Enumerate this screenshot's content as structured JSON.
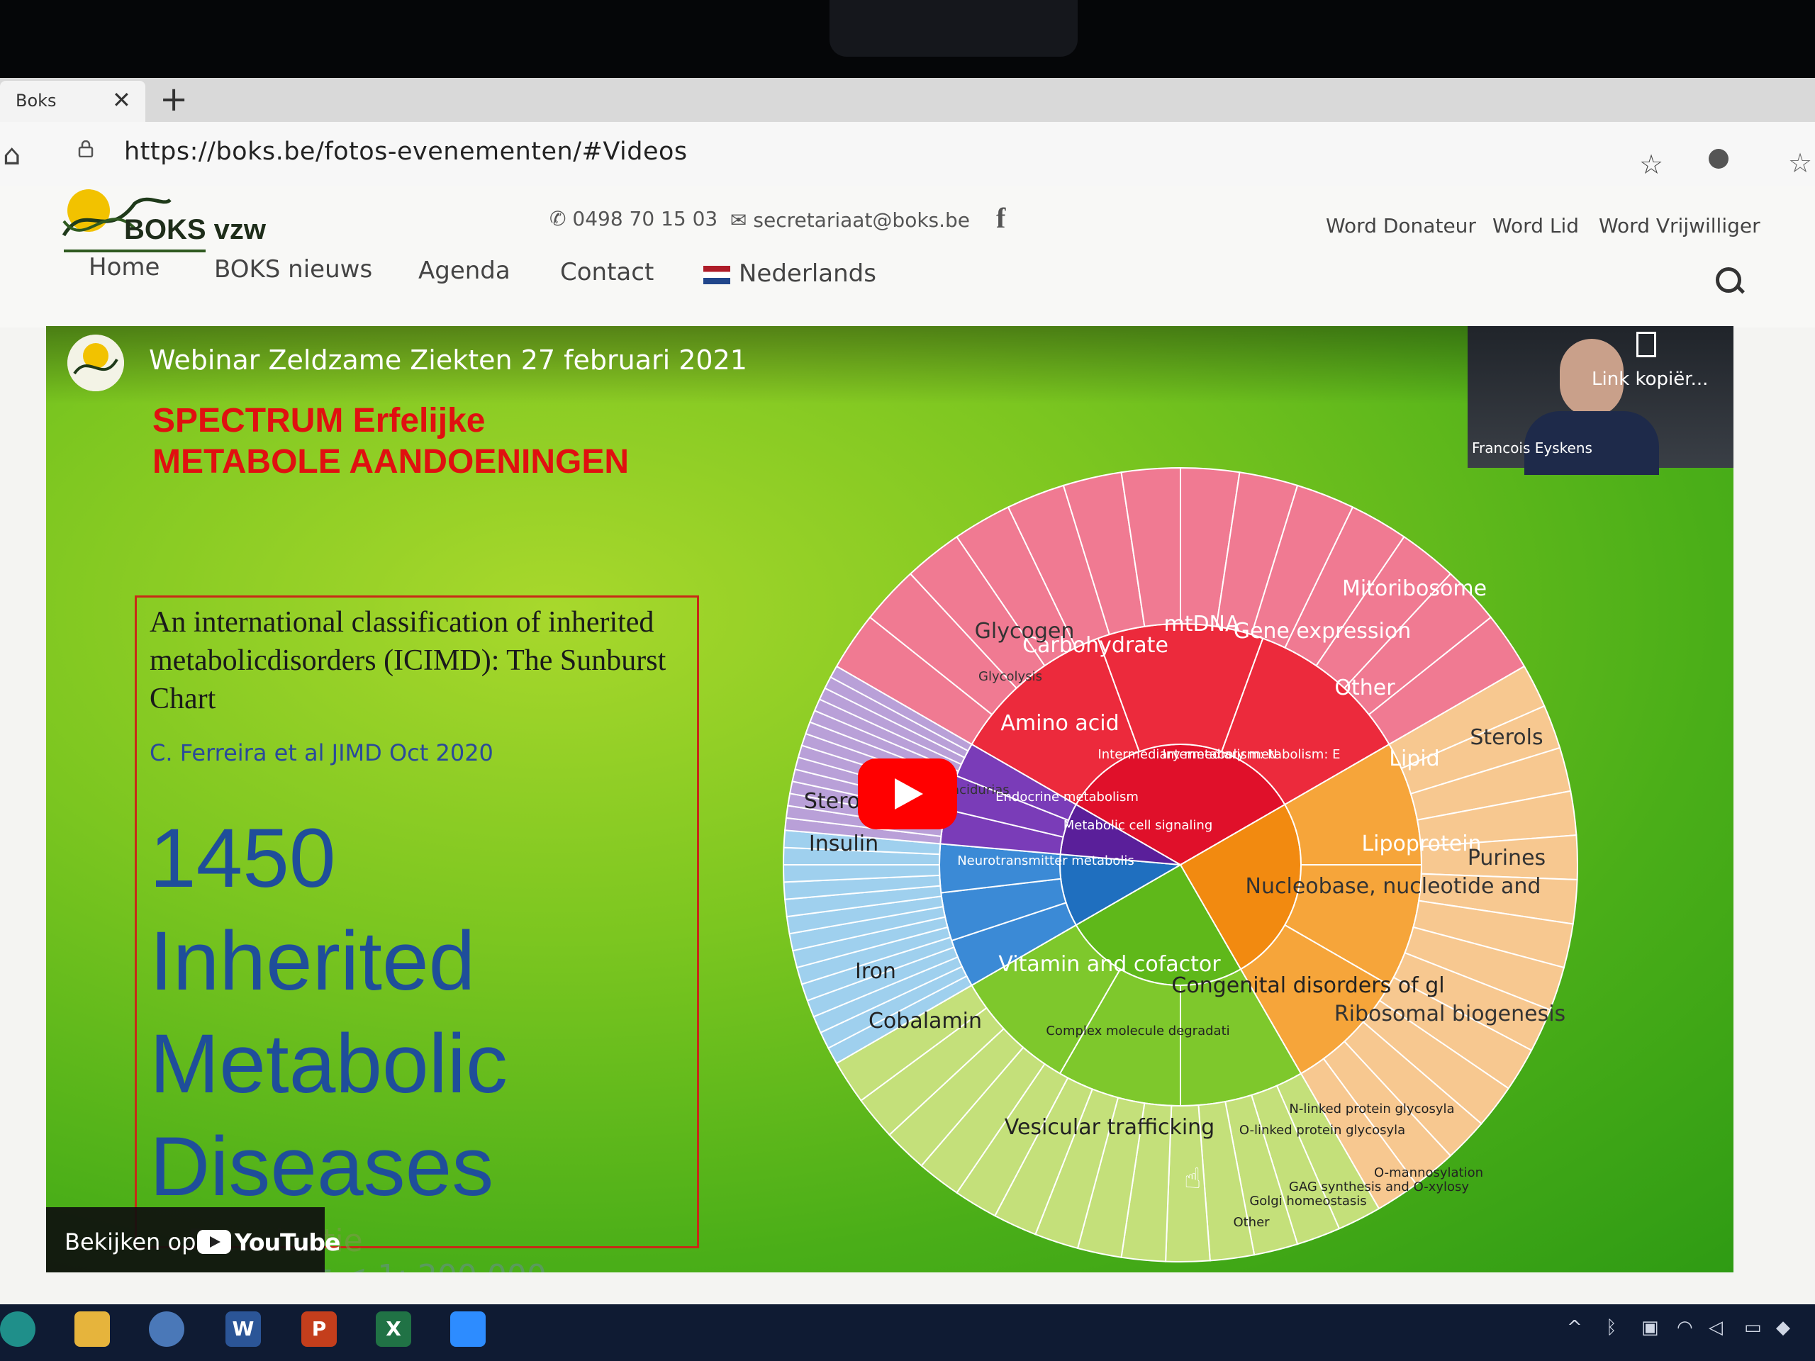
{
  "browser": {
    "tab_title": "Boks",
    "tab_close": "✕",
    "new_tab": "+",
    "url": "https://boks.be/fotos-evenementen/#Videos"
  },
  "site": {
    "logo_text": "BOKS vzw",
    "phone": "0498 70 15 03",
    "email": "secretariaat@boks.be",
    "facebook": "f",
    "top_links": [
      "Word Donateur",
      "Word Lid",
      "Word Vrijwilliger"
    ],
    "nav": [
      "Home",
      "BOKS nieuws",
      "Agenda",
      "Contact",
      "Nederlands"
    ]
  },
  "video": {
    "title": "Webinar Zeldzame Ziekten 27 februari 2021",
    "heading_line1": "SPECTRUM Erfelijke",
    "heading_line2": "METABOLE AANDOENINGEN",
    "box_title": "An international classification of inherited metabolicdisorders (ICIMD): The Sunburst Chart",
    "box_author": "C. Ferreira et al JIMD Oct 2020",
    "big_lines": [
      "1450",
      "Inherited",
      "Metabolic",
      "Diseases"
    ],
    "prevalence": "Prevalentie",
    "prevalence_value": "t < 1: 200.000",
    "watch_label": "Bekijken op",
    "youtube": "YouTube",
    "webcam_name": "Francois Eyskens",
    "copy_link": "Link kopiër..."
  },
  "sunburst_labels": [
    "Steroids",
    "Insulin",
    "Iron",
    "Cobalamin",
    "Amino acid",
    "Carbohydrate",
    "mtDNA",
    "Gene expression",
    "Other",
    "Mitoribosome",
    "Lipid",
    "Lipoprotein",
    "Sterols",
    "Purines",
    "Nucleobase, nucleotide and nucleic acid",
    "Ribosomal biogenesis",
    "Congenital disorders of glycosylation",
    "Vesicular trafficking",
    "Vitamin and cofactor",
    "Glycogen",
    "Glycolysis",
    "Organic acidurias",
    "Endocrine metabolism",
    "Neurotransmitter metabolism",
    "Metabolic cell signaling",
    "Intermediary metabolism: Nutrients",
    "Intermediary metabolism: Energy",
    "Complex molecule degradation",
    "N-linked protein glycosylation",
    "O-linked protein glycosylation",
    "O-mannosylation",
    "GAG synthesis and O-xylosylation",
    "Golgi homeostasis",
    "Other"
  ],
  "taskbar": [
    "W",
    "P",
    "X"
  ]
}
